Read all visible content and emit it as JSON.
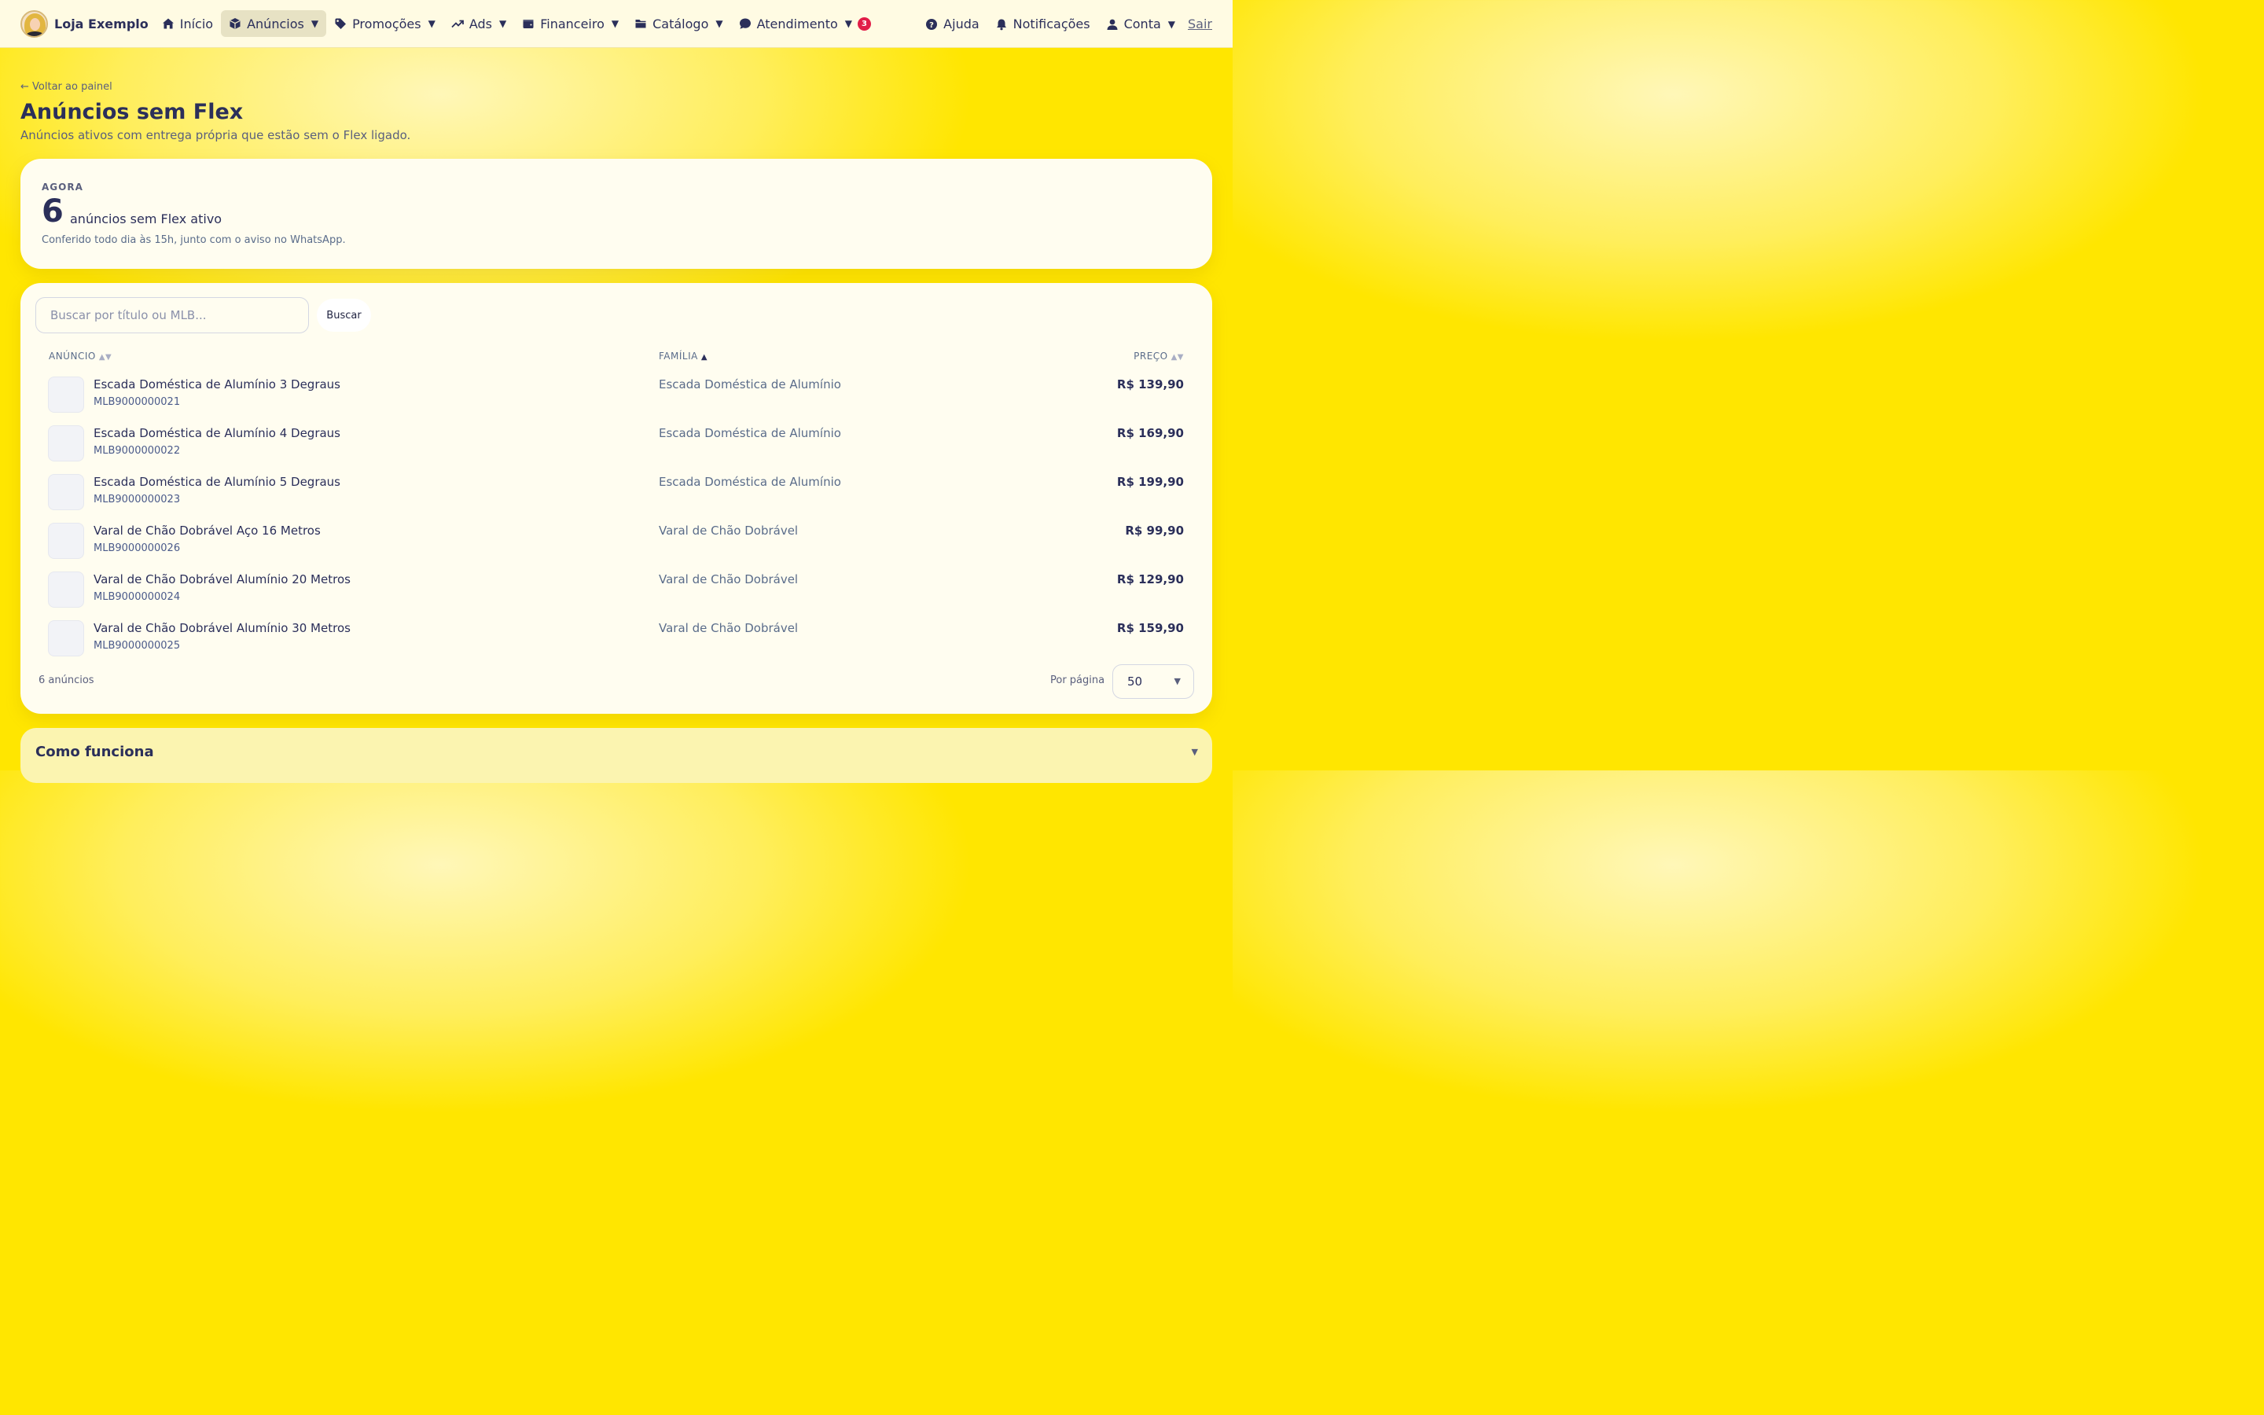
{
  "brand": {
    "name": "Loja Exemplo"
  },
  "nav": [
    {
      "label": "Início",
      "icon": "home-icon"
    },
    {
      "label": "Anúncios",
      "icon": "box-icon",
      "active": true,
      "dropdown": true
    },
    {
      "label": "Promoções",
      "icon": "tag-icon",
      "dropdown": true
    },
    {
      "label": "Ads",
      "icon": "trending-up-icon",
      "dropdown": true
    },
    {
      "label": "Financeiro",
      "icon": "wallet-icon",
      "dropdown": true
    },
    {
      "label": "Catálogo",
      "icon": "folder-icon",
      "dropdown": true
    },
    {
      "label": "Atendimento",
      "icon": "chat-bubble-icon",
      "dropdown": true,
      "badge": "3"
    }
  ],
  "nav_right": {
    "help": "Ajuda",
    "notifications": "Notificações",
    "account": "Conta",
    "logout": "Sair"
  },
  "header": {
    "back": "← Voltar ao painel",
    "title": "Anúncios sem Flex",
    "subtitle": "Anúncios ativos com entrega própria que estão sem o Flex ligado."
  },
  "summary": {
    "label": "AGORA",
    "count": "6",
    "text": "anúncios sem Flex ativo",
    "note": "Conferido todo dia às 15h, junto com o aviso no WhatsApp."
  },
  "search": {
    "placeholder": "Buscar por título ou MLB...",
    "button": "Buscar"
  },
  "table": {
    "headers": {
      "anuncio": "ANÚNCIO",
      "familia": "FAMÍLIA",
      "preco": "PREÇO"
    },
    "rows": [
      {
        "title": "Escada Doméstica de Alumínio 3 Degraus",
        "mlb": "MLB9000000021",
        "family": "Escada Doméstica de Alumínio",
        "price": "R$ 139,90"
      },
      {
        "title": "Escada Doméstica de Alumínio 4 Degraus",
        "mlb": "MLB9000000022",
        "family": "Escada Doméstica de Alumínio",
        "price": "R$ 169,90"
      },
      {
        "title": "Escada Doméstica de Alumínio 5 Degraus",
        "mlb": "MLB9000000023",
        "family": "Escada Doméstica de Alumínio",
        "price": "R$ 199,90"
      },
      {
        "title": "Varal de Chão Dobrável Aço 16 Metros",
        "mlb": "MLB9000000026",
        "family": "Varal de Chão Dobrável",
        "price": "R$ 99,90"
      },
      {
        "title": "Varal de Chão Dobrável Alumínio 20 Metros",
        "mlb": "MLB9000000024",
        "family": "Varal de Chão Dobrável",
        "price": "R$ 129,90"
      },
      {
        "title": "Varal de Chão Dobrável Alumínio 30 Metros",
        "mlb": "MLB9000000025",
        "family": "Varal de Chão Dobrável",
        "price": "R$ 159,90"
      }
    ]
  },
  "footer": {
    "count": "6 anúncios",
    "per_page_label": "Por página",
    "per_page_value": "50"
  },
  "howto": {
    "title": "Como funciona"
  },
  "colors": {
    "background": "#ffe600",
    "accent": "#2b2f5a",
    "badge": "#e11d48"
  }
}
